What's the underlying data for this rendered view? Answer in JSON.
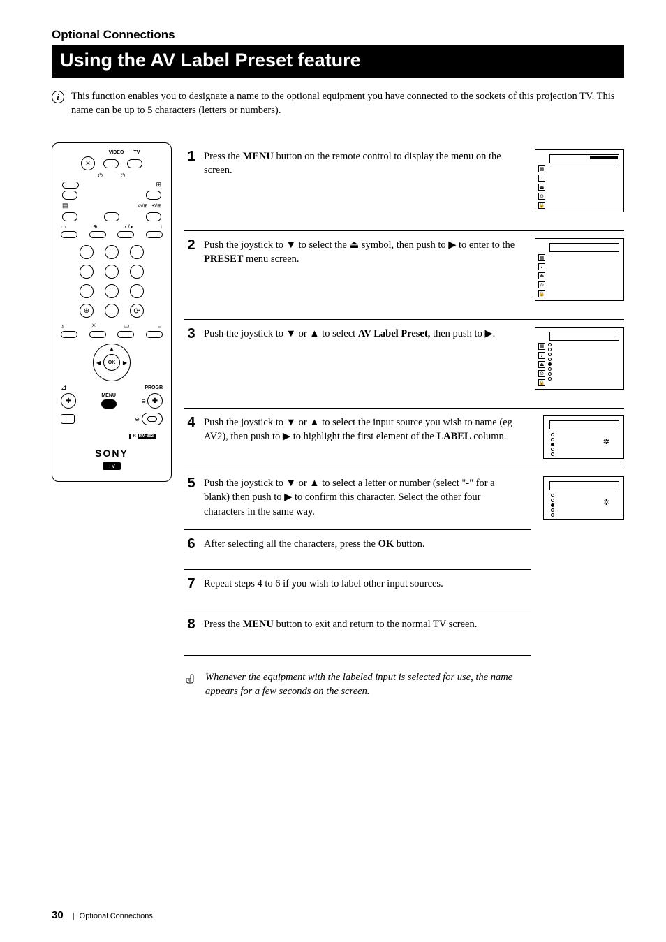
{
  "section_heading": "Optional Connections",
  "title": "Using the AV Label Preset feature",
  "intro": "This function enables you to designate a name to the optional equipment you have connected to the sockets of this projection TV. This name can be up to 5 characters (letters or numbers).",
  "info_symbol": "i",
  "steps": [
    {
      "n": "1",
      "text_a": "Press the ",
      "bold_a": "MENU",
      "text_b": " button on the remote control to display the menu on the screen.",
      "thumb": "full"
    },
    {
      "n": "2",
      "text_a": "Push the joystick to ▼ to select the  ",
      "icon": "⏏",
      "text_b": "  symbol, then push to ▶ to enter to the ",
      "bold_a": "PRESET",
      "text_c": " menu screen.",
      "thumb": "full"
    },
    {
      "n": "3",
      "text_a": "Push the joystick to ▼ or ▲ to select ",
      "bold_a": "AV Label Preset,",
      "text_b": " then push to ▶.",
      "thumb": "full_dots"
    },
    {
      "n": "4",
      "text_a": "Push the joystick to ▼ or ▲ to select the input source you wish to name (eg AV2), then push to ▶ to highlight the first element of the ",
      "bold_a": "LABEL",
      "text_b": " column.",
      "thumb": "small"
    },
    {
      "n": "5",
      "text_a": "Push the joystick to ▼ or ▲ to select a letter or number (select \"-\" for a blank) then push to ▶ to confirm this character. Select the other four characters in the same way.",
      "thumb": "small"
    },
    {
      "n": "6",
      "text_a": "After selecting all the characters, press the ",
      "bold_a": "OK",
      "text_b": " button."
    },
    {
      "n": "7",
      "text_a": "Repeat steps 4 to 6 if you wish to label other input sources."
    },
    {
      "n": "8",
      "text_a": "Press the ",
      "bold_a": "MENU",
      "text_b": " button to exit and return to the normal TV screen."
    }
  ],
  "remote": {
    "video_lbl": "VIDEO",
    "tv_lbl": "TV",
    "ok": "OK",
    "progr": "PROGR",
    "menu": "MENU",
    "rm": "RM-892",
    "brand": "SONY",
    "tv_tag": "TV"
  },
  "note": "Whenever the equipment with the labeled input is selected for use, the name appears for a few seconds on the screen.",
  "footer": {
    "page": "30",
    "sep": "|",
    "section": "Optional Connections"
  }
}
